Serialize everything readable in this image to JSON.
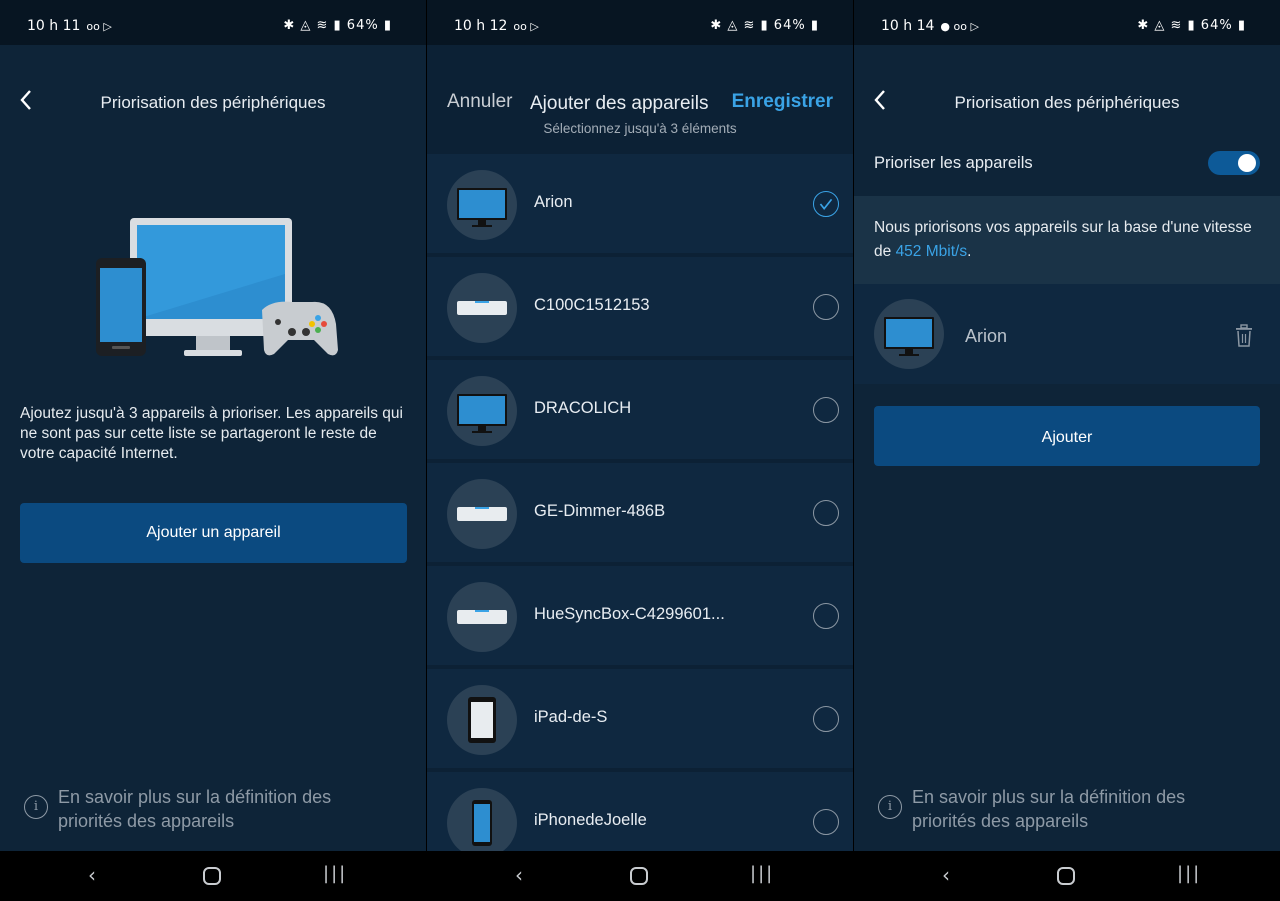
{
  "status_bars": [
    {
      "time": "10 h 11",
      "right": "64%"
    },
    {
      "time": "10 h 12",
      "right": "64%"
    },
    {
      "time": "10 h 14",
      "right": "64%"
    }
  ],
  "screen1": {
    "title": "Priorisation des périphériques",
    "description": "Ajoutez jusqu'à 3 appareils à prioriser. Les appareils qui ne sont pas sur cette liste se partageront le reste de votre capacité Internet.",
    "add_button": "Ajouter un appareil",
    "info_link": "En savoir plus sur la définition des priorités des appareils"
  },
  "screen2": {
    "cancel": "Annuler",
    "title": "Ajouter des appareils",
    "save": "Enregistrer",
    "subtitle": "Sélectionnez jusqu'à 3 éléments",
    "devices": [
      {
        "name": "Arion",
        "icon": "monitor-icon",
        "selected": true
      },
      {
        "name": "C100C1512153",
        "icon": "router-icon",
        "selected": false
      },
      {
        "name": "DRACOLICH",
        "icon": "monitor-icon",
        "selected": false
      },
      {
        "name": "GE-Dimmer-486B",
        "icon": "router-icon",
        "selected": false
      },
      {
        "name": "HueSyncBox-C4299601...",
        "icon": "router-icon",
        "selected": false
      },
      {
        "name": "iPad-de-S",
        "icon": "tablet-icon",
        "selected": false
      },
      {
        "name": "iPhonedeJoelle",
        "icon": "phone-icon",
        "selected": false
      }
    ]
  },
  "screen3": {
    "title": "Priorisation des périphériques",
    "toggle_label": "Prioriser les appareils",
    "toggle_on": true,
    "info_prefix": "Nous priorisons vos appareils sur la base d'une vitesse de ",
    "speed": "452 Mbit/s",
    "info_suffix": ".",
    "device_name": "Arion",
    "add_button": "Ajouter",
    "info_link": "En savoir plus sur la définition des priorités des appareils"
  },
  "colors": {
    "accent": "#3aa3e6",
    "button": "#0b4a80",
    "background": "#0e2438"
  }
}
